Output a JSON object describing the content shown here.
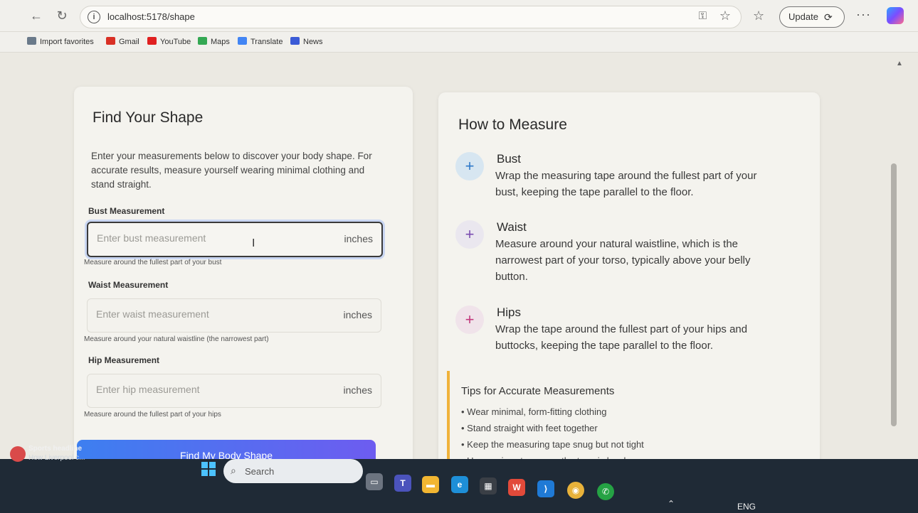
{
  "browser": {
    "url": "localhost:5178/shape",
    "update_label": "Update",
    "bookmarks": [
      {
        "label": "Import favorites",
        "color": "#6a7a8a"
      },
      {
        "label": "Gmail",
        "color": "#d93025"
      },
      {
        "label": "YouTube",
        "color": "#e02020"
      },
      {
        "label": "Maps",
        "color": "#34a853"
      },
      {
        "label": "Translate",
        "color": "#4285f4"
      },
      {
        "label": "News",
        "color": "#3b5bd6"
      }
    ]
  },
  "form": {
    "title": "Find Your Shape",
    "intro": "Enter your measurements below to discover your body shape. For accurate results, measure yourself wearing minimal clothing and stand straight.",
    "bust": {
      "label": "Bust Measurement",
      "placeholder": "Enter bust measurement",
      "unit": "inches",
      "hint": "Measure around the fullest part of your bust"
    },
    "waist": {
      "label": "Waist Measurement",
      "placeholder": "Enter waist measurement",
      "unit": "inches",
      "hint": "Measure around your natural waistline (the narrowest part)"
    },
    "hip": {
      "label": "Hip Measurement",
      "placeholder": "Enter hip measurement",
      "unit": "inches",
      "hint": "Measure around the fullest part of your hips"
    },
    "submit_label": "Find My Body Shape"
  },
  "guide": {
    "title": "How to Measure",
    "items": [
      {
        "title": "Bust",
        "text": "Wrap the measuring tape around the fullest part of your bust, keeping the tape parallel to the floor.",
        "badge_bg": "#d7e6f1",
        "badge_color": "#2f79c9"
      },
      {
        "title": "Waist",
        "text": "Measure around your natural waistline, which is the narrowest part of your torso, typically above your belly button.",
        "badge_bg": "#eae7ef",
        "badge_color": "#7b4db1"
      },
      {
        "title": "Hips",
        "text": "Wrap the tape around the fullest part of your hips and buttocks, keeping the tape parallel to the floor.",
        "badge_bg": "#f0e3ea",
        "badge_color": "#c23a7d"
      }
    ],
    "tips_title": "Tips for Accurate Measurements",
    "tips": [
      "Wear minimal, form-fitting clothing",
      "Stand straight with feet together",
      "Keep the measuring tape snug but not tight",
      "Use a mirror to ensure the tape is level"
    ]
  },
  "taskbar": {
    "news_title": "Sports headline",
    "news_sub": "How Liverpool c...",
    "search_label": "Search",
    "language": "ENG"
  }
}
